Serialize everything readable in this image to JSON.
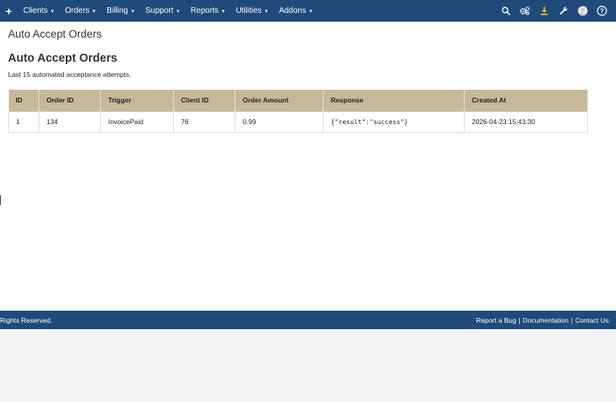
{
  "navbar": {
    "plus_icon": "plus-icon",
    "menu": [
      {
        "label": "Clients"
      },
      {
        "label": "Orders"
      },
      {
        "label": "Billing"
      },
      {
        "label": "Support"
      },
      {
        "label": "Reports"
      },
      {
        "label": "Utilities"
      },
      {
        "label": "Addons"
      }
    ],
    "caret": "▾",
    "right_icons": [
      "search-icon",
      "cogs-icon",
      "download-icon",
      "wrench-icon",
      "avatar-icon",
      "help-icon"
    ],
    "download_color": "#f5c518"
  },
  "page": {
    "breadcrumb_title": "Auto Accept Orders",
    "title": "Auto Accept Orders",
    "subtitle": "Last 15 automated acceptance attempts."
  },
  "table": {
    "headers": [
      "ID",
      "Order ID",
      "Trigger",
      "Client ID",
      "Order Amount",
      "Response",
      "Created At"
    ],
    "rows": [
      [
        "1",
        "134",
        "InvoicePaid",
        "76",
        "0.99",
        "{\"result\":\"success\"}",
        "2026-04-23 15:43:30"
      ]
    ],
    "header_color": "#c8b89a"
  },
  "footer": {
    "left_text": "Rights Reserved.",
    "links": [
      "Report a Bug",
      "Documentation",
      "Contact Us"
    ],
    "separator": "|"
  },
  "colors": {
    "navbar": "#1f4a7a",
    "footer": "#1f4a7a"
  }
}
